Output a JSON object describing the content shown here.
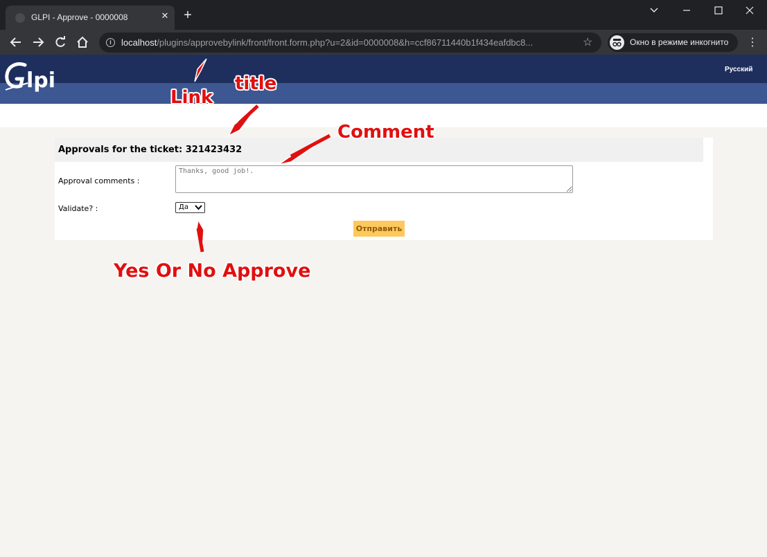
{
  "browser": {
    "tab_title": "GLPI - Approve - 0000008",
    "url_host": "localhost",
    "url_path": "/plugins/approvebylink/front/front.form.php?u=2&id=0000008&h=ccf86711440b1f434eafdbc8...",
    "incognito_label": "Окно в режиме инкогнито"
  },
  "glpi": {
    "logo_text": "Glpi",
    "language": "Русский"
  },
  "form": {
    "title": "Approvals for the ticket: 321423432",
    "comments_label": "Approval comments :",
    "comments_placeholder": "Thanks, good job!.",
    "validate_label": "Validate? :",
    "validate_value": "Да",
    "submit_label": "Отправить"
  },
  "annotations": {
    "link": "Link",
    "title": "title",
    "comment": "Comment",
    "approve": "Yes Or No Approve"
  },
  "colors": {
    "header_dark": "#1e2f5e",
    "header_light": "#3c5791",
    "submit_bg": "#fec95c",
    "annotation": "#e01010"
  }
}
